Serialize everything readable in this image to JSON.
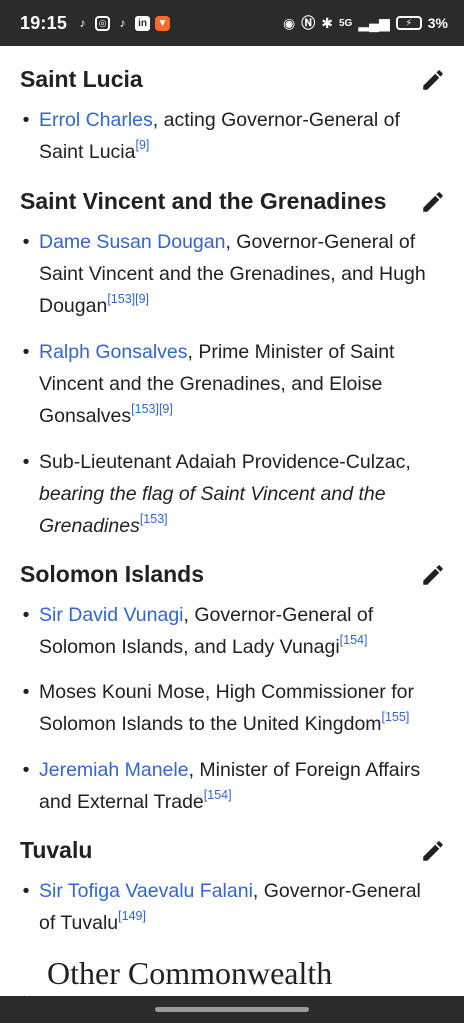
{
  "status": {
    "time": "19:15",
    "apps": [
      "tiktok-icon",
      "instagram-icon",
      "tiktok-icon",
      "linkedin-icon",
      "brave-icon"
    ],
    "network": "5G",
    "battery": "3%"
  },
  "sections": [
    {
      "title": "Saint Lucia",
      "items": [
        {
          "link": "Errol Charles",
          "text": ", acting Governor-General of Saint Lucia",
          "refs": "[9]"
        }
      ]
    },
    {
      "title": "Saint Vincent and the Grenadines",
      "items": [
        {
          "link": "Dame Susan Dougan",
          "text": ", Governor-General of Saint Vincent and the Grenadines, and Hugh Dougan",
          "refs": "[153][9]"
        },
        {
          "link": "Ralph Gonsalves",
          "text": ", Prime Minister of Saint Vincent and the Grenadines, and Eloise Gonsalves",
          "refs": "[153][9]"
        },
        {
          "link": "",
          "text": "Sub-Lieutenant Adaiah Providence-Culzac, ",
          "italic": "bearing the flag of Saint Vincent and the Grenadines",
          "refs": "[153]"
        }
      ]
    },
    {
      "title": "Solomon Islands",
      "items": [
        {
          "link": "Sir David Vunagi",
          "text": ", Governor-General of Solomon Islands, and Lady Vunagi",
          "refs": "[154]"
        },
        {
          "link": "",
          "text": "Moses Kouni Mose, High Commissioner for Solomon Islands to the United Kingdom",
          "refs": "[155]"
        },
        {
          "link": "Jeremiah Manele",
          "text": ", Minister of Foreign Affairs and External Trade",
          "refs": "[154]"
        }
      ]
    },
    {
      "title": "Tuvalu",
      "items": [
        {
          "link": "Sir Tofiga Vaevalu Falani",
          "text": ", Governor-General of Tuvalu",
          "refs": "[149]"
        }
      ]
    }
  ],
  "next_heading": "Other Commonwealth",
  "colors": {
    "link": "#3366cc",
    "text": "#202122",
    "status_bar": "#2b2b2b"
  }
}
